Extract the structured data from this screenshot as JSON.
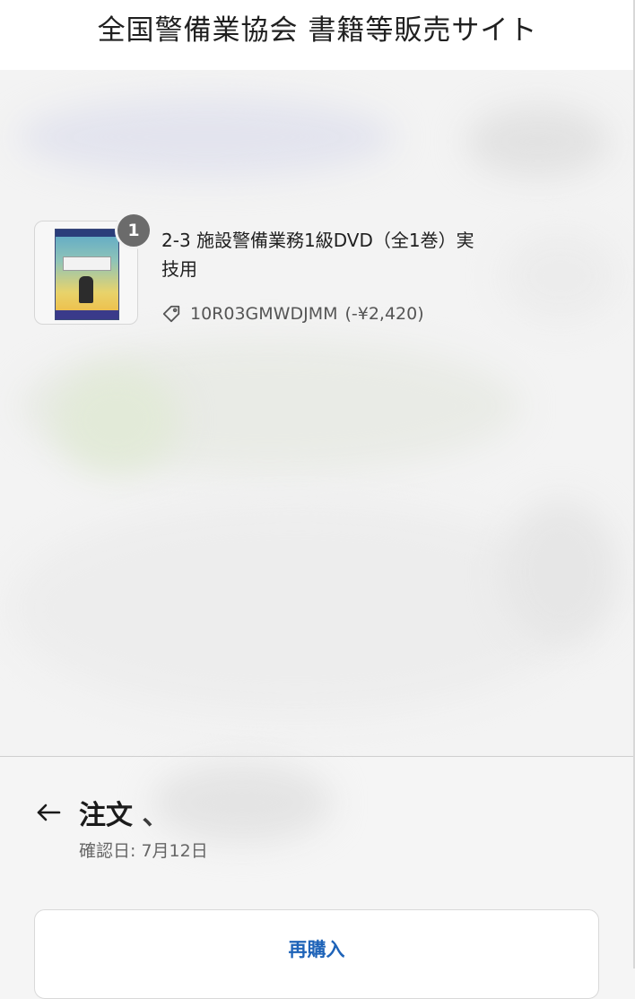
{
  "header": {
    "title": "全国警備業協会 書籍等販売サイト"
  },
  "order_summary": {
    "item": {
      "quantity": "1",
      "name": "2-3 施設警備業務1級DVD（全1巻）実技用",
      "discount_code": "10R03GMWDJMM",
      "discount_amount": "(-¥2,420)"
    }
  },
  "order": {
    "title": "注文",
    "separator": "、",
    "confirm_date": "確認日: 7月12日",
    "rebuy_label": "再購入"
  },
  "icons": {
    "back": "arrow-left-icon",
    "tag": "tag-icon"
  },
  "colors": {
    "accent": "#1e63b8",
    "badge": "#6b6b6b"
  }
}
